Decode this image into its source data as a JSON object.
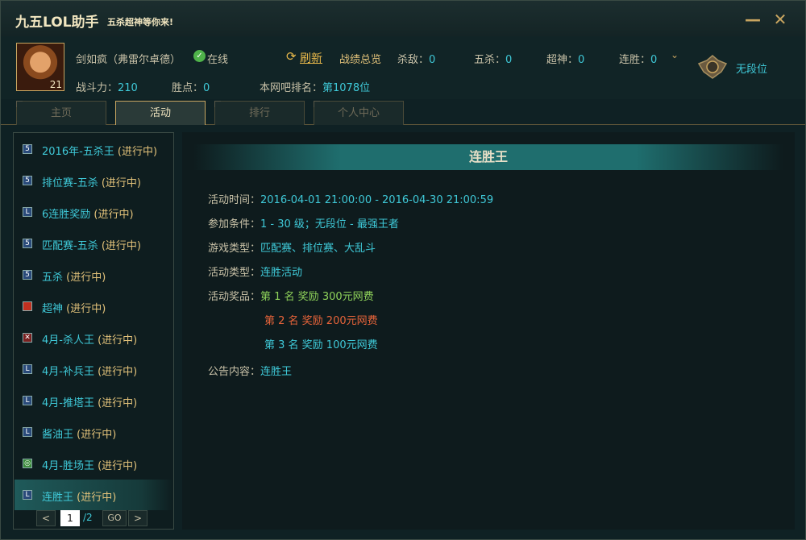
{
  "app": {
    "title": "九五LOL助手",
    "slogan": "五杀超神等你来!"
  },
  "window": {
    "minimize": "—",
    "close": "✕"
  },
  "profile": {
    "avatar_level": "21",
    "name": "剑如疯（弗雷尔卓德）",
    "status": "在线",
    "refresh": "刷新",
    "overview": "战绩总览",
    "kills_label": "杀敌：",
    "kills": "0",
    "penta_label": "五杀：",
    "penta": "0",
    "legendary_label": "超神：",
    "legendary": "0",
    "streak_label": "连胜：",
    "streak": "0",
    "rank": "无段位",
    "power_label": "战斗力：",
    "power": "210",
    "points_label": "胜点：",
    "points": "0",
    "ranking_label": "本网吧排名：",
    "ranking": "第1078位"
  },
  "tabs": [
    {
      "label": "主页"
    },
    {
      "label": "活动"
    },
    {
      "label": "排行"
    },
    {
      "label": "个人中心"
    }
  ],
  "sidebar": {
    "items": [
      {
        "name": "2016年-五杀王",
        "status": "(进行中)"
      },
      {
        "name": "排位赛-五杀",
        "status": "(进行中)"
      },
      {
        "name": "6连胜奖励",
        "status": "(进行中)"
      },
      {
        "name": "匹配赛-五杀",
        "status": "(进行中)"
      },
      {
        "name": "五杀",
        "status": "(进行中)"
      },
      {
        "name": "超神",
        "status": "(进行中)"
      },
      {
        "name": "4月-杀人王",
        "status": "(进行中)"
      },
      {
        "name": "4月-补兵王",
        "status": "(进行中)"
      },
      {
        "name": "4月-推塔王",
        "status": "(进行中)"
      },
      {
        "name": "酱油王",
        "status": "(进行中)"
      },
      {
        "name": "4月-胜场王",
        "status": "(进行中)"
      },
      {
        "name": "连胜王",
        "status": "(进行中)"
      }
    ],
    "pager": {
      "prev": "<",
      "page": "1",
      "total": "/2",
      "go": "GO",
      "next": ">"
    }
  },
  "detail": {
    "title": "连胜王",
    "time_label": "活动时间：",
    "time": "2016-04-01 21:00:00 - 2016-04-30 21:00:59",
    "cond_label": "参加条件：",
    "cond": "1 - 30 级；无段位 - 最强王者",
    "mode_label": "游戏类型：",
    "mode": "匹配赛、排位赛、大乱斗",
    "type_label": "活动类型：",
    "type": "连胜活动",
    "prize_label": "活动奖品：",
    "prize1": "第 1 名  奖励  300元网费",
    "prize2": "第 2 名  奖励  200元网费",
    "prize3": "第 3 名  奖励  100元网费",
    "notice_label": "公告内容：",
    "notice": "连胜王"
  },
  "colors": {
    "accent": "#3fc9d8",
    "gold": "#e8b84a",
    "prize1": "#8fd35a",
    "prize2": "#e8643a",
    "prize3": "#3fc9d8"
  }
}
